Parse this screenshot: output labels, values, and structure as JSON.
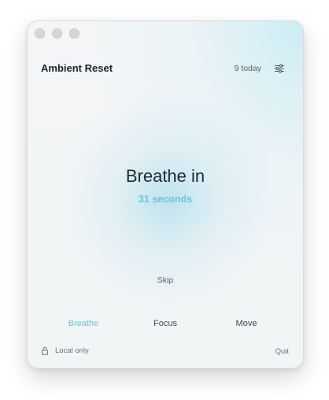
{
  "window": {
    "title": "Ambient Reset",
    "today_count": "9 today"
  },
  "icons": {
    "settings": "sliders-icon",
    "lock": "lock-icon"
  },
  "session": {
    "prompt": "Breathe in",
    "remaining": "31 seconds",
    "skip_label": "Skip"
  },
  "modes": [
    {
      "label": "Breathe",
      "active": true
    },
    {
      "label": "Focus",
      "active": false
    },
    {
      "label": "Move",
      "active": false
    }
  ],
  "footer": {
    "privacy_label": "Local only",
    "quit_label": "Quit"
  },
  "colors": {
    "accent": "#6cc3df",
    "text_primary": "#1e2a32",
    "text_muted": "#6a7277"
  }
}
